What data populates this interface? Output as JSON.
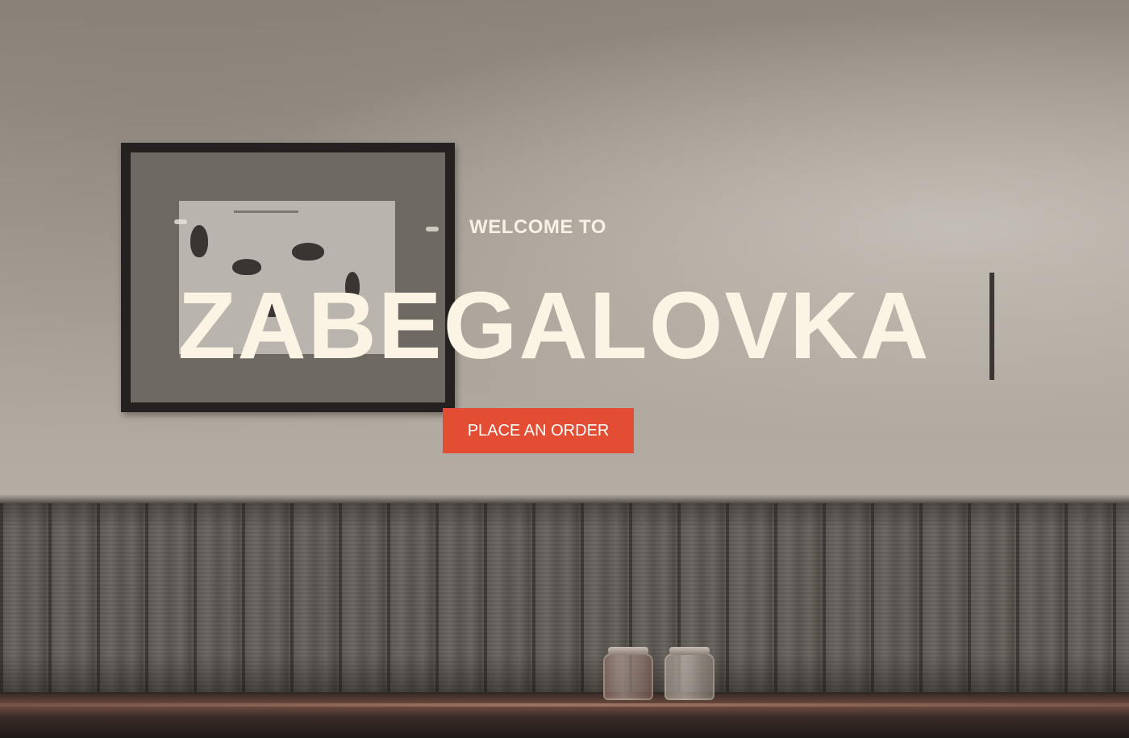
{
  "hero": {
    "welcome_text": "WELCOME TO",
    "title": "ZABEGALOVKA",
    "order_button_label": "PLACE AN ORDER"
  },
  "colors": {
    "accent": "#e24d34",
    "title_text": "#fbf3e4",
    "cursor_bar": "#3b3633"
  }
}
